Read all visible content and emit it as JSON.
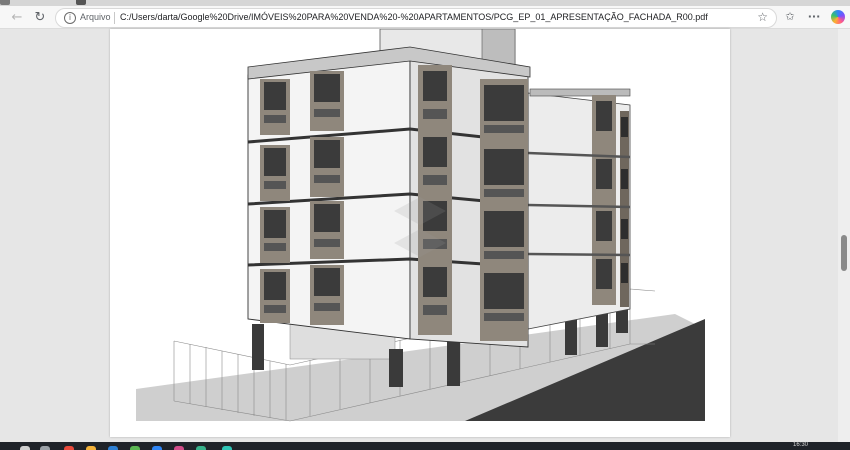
{
  "browser": {
    "address_bar": {
      "scheme_label": "Arquivo",
      "url": "C:/Users/darta/Google%20Drive/IMÓVEIS%20PARA%20VENDA%20-%20APARTAMENTOS/PCG_EP_01_APRESENTAÇÃO_FACHADA_R00.pdf"
    }
  },
  "document": {
    "image_description_alt": "Building facade rendering"
  },
  "taskbar": {
    "clock": "16:30"
  },
  "colors": {
    "wall_light": "#f4f4f4",
    "wall_shade": "#d8d8d8",
    "frame_brown": "#8f877c",
    "window_dark": "#3b3b3b",
    "street": "#3a3a3a"
  }
}
